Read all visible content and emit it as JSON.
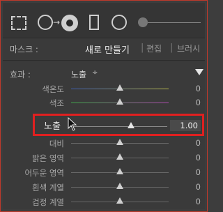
{
  "mask": {
    "label": "마스크 :",
    "new_label": "새로 만들기",
    "edit_label": "편집",
    "brush_label": "브러시",
    "separator": "|"
  },
  "effect": {
    "label": "효과 :",
    "value": "노출",
    "arrow": "÷"
  },
  "sliders": [
    {
      "label": "색온도",
      "value": "0"
    },
    {
      "label": "색조",
      "value": "0"
    },
    {
      "label": "노출",
      "value": "1.00"
    },
    {
      "label": "대비",
      "value": "0"
    },
    {
      "label": "밝은 영역",
      "value": "0"
    },
    {
      "label": "어두운 영역",
      "value": "0"
    },
    {
      "label": "흰색 계열",
      "value": "0"
    },
    {
      "label": "검정 계열",
      "value": "0"
    }
  ],
  "icons": [
    "marquee-icon",
    "spot-removal-icon",
    "red-eye-icon",
    "graduated-filter-icon",
    "radial-filter-icon",
    "brush-size-icon"
  ],
  "colors": {
    "highlight": "#e02020",
    "panel": "#3a3a3a"
  }
}
